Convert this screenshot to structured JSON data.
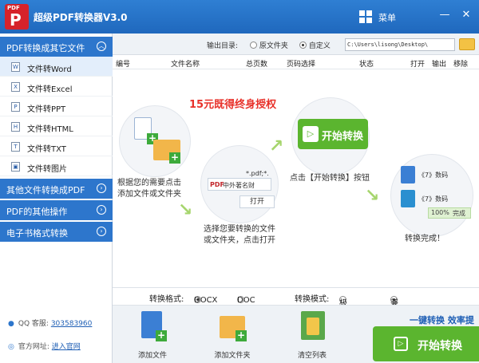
{
  "titlebar": {
    "logo_tag": "PDF",
    "title": "超级PDF转换器V3.0",
    "menu": "菜单",
    "min": "—",
    "close": "✕",
    "menu_icon": "grid-icon"
  },
  "sidebar": {
    "cat1": "PDF转换成其它文件",
    "items": [
      {
        "label": "文件转Word",
        "icon": "W"
      },
      {
        "label": "文件转Excel",
        "icon": "X"
      },
      {
        "label": "文件转PPT",
        "icon": "P"
      },
      {
        "label": "文件转HTML",
        "icon": "H"
      },
      {
        "label": "文件转TXT",
        "icon": "T"
      },
      {
        "label": "文件转图片",
        "icon": "▣"
      }
    ],
    "cat2": "其他文件转换成PDF",
    "cat3": "PDF的其他操作",
    "cat4": "电子书格式转换",
    "qq_label": "QQ 客服:",
    "qq_value": "303583960",
    "site_label": "官方网址:",
    "site_link": "进入官网"
  },
  "outbar": {
    "label": "输出目录:",
    "opt1": "原文件夹",
    "opt2": "自定义",
    "path": "C:\\Users\\lisong\\Desktop\\"
  },
  "columns": [
    "编号",
    "文件名称",
    "总页数",
    "页码选择",
    "状态",
    "打开",
    "输出",
    "移除"
  ],
  "main": {
    "promo": "15元既得终身授权",
    "step1": [
      "根据您的需要点击",
      "添加文件或文件夹"
    ],
    "step2": [
      "选择您要转换的文件",
      "或文件夹，点击打开"
    ],
    "step3": "点击【开始转换】按钮",
    "step4": "转换完成！",
    "demo_start": "开始转换",
    "demo_file": "中外著名财",
    "demo_ext": "*.pdf;*.",
    "demo_open": "打开",
    "demo_row1": "《7》数码",
    "demo_row2": "《7》数码",
    "demo_progress": "100%",
    "demo_done": "完成"
  },
  "format": {
    "label": "转换格式:",
    "opt1": "DOCX",
    "opt2": "DOC",
    "mode_label": "转换模式:",
    "mode1": "极速模式",
    "mode2": "兼容模式"
  },
  "bottom": {
    "add_file": "添加文件",
    "add_folder": "添加文件夹",
    "clear": "清空列表",
    "slogan": "一键转换  效率提",
    "start": "开始转换"
  },
  "colors": {
    "accent": "#2d76cc",
    "green": "#5bb52f",
    "promo_red": "#e8312a"
  }
}
